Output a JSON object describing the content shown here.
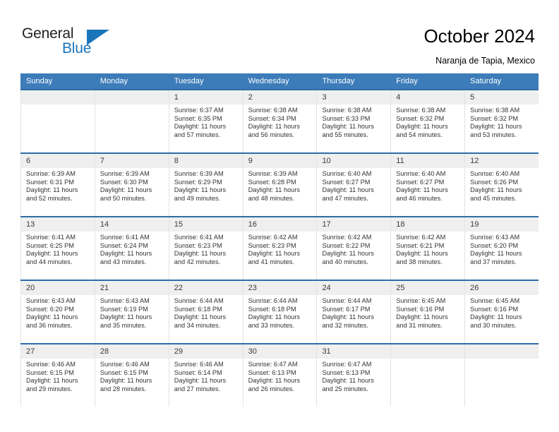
{
  "brand": {
    "name_top": "General",
    "name_bottom": "Blue",
    "accent_color": "#1b75bb",
    "triangle_icon": "brand-triangle-icon"
  },
  "header": {
    "title": "October 2024",
    "subtitle": "Naranja de Tapia, Mexico"
  },
  "calendar": {
    "header_color": "#3c7cb9",
    "row_border_color": "#2f6ca8",
    "day_band_color": "#efefef",
    "weekdays": [
      "Sunday",
      "Monday",
      "Tuesday",
      "Wednesday",
      "Thursday",
      "Friday",
      "Saturday"
    ],
    "weeks": [
      [
        {
          "day": "",
          "empty": true
        },
        {
          "day": "",
          "empty": true
        },
        {
          "day": "1",
          "sunrise": "Sunrise: 6:37 AM",
          "sunset": "Sunset: 6:35 PM",
          "daylight_1": "Daylight: 11 hours",
          "daylight_2": "and 57 minutes."
        },
        {
          "day": "2",
          "sunrise": "Sunrise: 6:38 AM",
          "sunset": "Sunset: 6:34 PM",
          "daylight_1": "Daylight: 11 hours",
          "daylight_2": "and 56 minutes."
        },
        {
          "day": "3",
          "sunrise": "Sunrise: 6:38 AM",
          "sunset": "Sunset: 6:33 PM",
          "daylight_1": "Daylight: 11 hours",
          "daylight_2": "and 55 minutes."
        },
        {
          "day": "4",
          "sunrise": "Sunrise: 6:38 AM",
          "sunset": "Sunset: 6:32 PM",
          "daylight_1": "Daylight: 11 hours",
          "daylight_2": "and 54 minutes."
        },
        {
          "day": "5",
          "sunrise": "Sunrise: 6:38 AM",
          "sunset": "Sunset: 6:32 PM",
          "daylight_1": "Daylight: 11 hours",
          "daylight_2": "and 53 minutes."
        }
      ],
      [
        {
          "day": "6",
          "sunrise": "Sunrise: 6:39 AM",
          "sunset": "Sunset: 6:31 PM",
          "daylight_1": "Daylight: 11 hours",
          "daylight_2": "and 52 minutes."
        },
        {
          "day": "7",
          "sunrise": "Sunrise: 6:39 AM",
          "sunset": "Sunset: 6:30 PM",
          "daylight_1": "Daylight: 11 hours",
          "daylight_2": "and 50 minutes."
        },
        {
          "day": "8",
          "sunrise": "Sunrise: 6:39 AM",
          "sunset": "Sunset: 6:29 PM",
          "daylight_1": "Daylight: 11 hours",
          "daylight_2": "and 49 minutes."
        },
        {
          "day": "9",
          "sunrise": "Sunrise: 6:39 AM",
          "sunset": "Sunset: 6:28 PM",
          "daylight_1": "Daylight: 11 hours",
          "daylight_2": "and 48 minutes."
        },
        {
          "day": "10",
          "sunrise": "Sunrise: 6:40 AM",
          "sunset": "Sunset: 6:27 PM",
          "daylight_1": "Daylight: 11 hours",
          "daylight_2": "and 47 minutes."
        },
        {
          "day": "11",
          "sunrise": "Sunrise: 6:40 AM",
          "sunset": "Sunset: 6:27 PM",
          "daylight_1": "Daylight: 11 hours",
          "daylight_2": "and 46 minutes."
        },
        {
          "day": "12",
          "sunrise": "Sunrise: 6:40 AM",
          "sunset": "Sunset: 6:26 PM",
          "daylight_1": "Daylight: 11 hours",
          "daylight_2": "and 45 minutes."
        }
      ],
      [
        {
          "day": "13",
          "sunrise": "Sunrise: 6:41 AM",
          "sunset": "Sunset: 6:25 PM",
          "daylight_1": "Daylight: 11 hours",
          "daylight_2": "and 44 minutes."
        },
        {
          "day": "14",
          "sunrise": "Sunrise: 6:41 AM",
          "sunset": "Sunset: 6:24 PM",
          "daylight_1": "Daylight: 11 hours",
          "daylight_2": "and 43 minutes."
        },
        {
          "day": "15",
          "sunrise": "Sunrise: 6:41 AM",
          "sunset": "Sunset: 6:23 PM",
          "daylight_1": "Daylight: 11 hours",
          "daylight_2": "and 42 minutes."
        },
        {
          "day": "16",
          "sunrise": "Sunrise: 6:42 AM",
          "sunset": "Sunset: 6:23 PM",
          "daylight_1": "Daylight: 11 hours",
          "daylight_2": "and 41 minutes."
        },
        {
          "day": "17",
          "sunrise": "Sunrise: 6:42 AM",
          "sunset": "Sunset: 6:22 PM",
          "daylight_1": "Daylight: 11 hours",
          "daylight_2": "and 40 minutes."
        },
        {
          "day": "18",
          "sunrise": "Sunrise: 6:42 AM",
          "sunset": "Sunset: 6:21 PM",
          "daylight_1": "Daylight: 11 hours",
          "daylight_2": "and 38 minutes."
        },
        {
          "day": "19",
          "sunrise": "Sunrise: 6:43 AM",
          "sunset": "Sunset: 6:20 PM",
          "daylight_1": "Daylight: 11 hours",
          "daylight_2": "and 37 minutes."
        }
      ],
      [
        {
          "day": "20",
          "sunrise": "Sunrise: 6:43 AM",
          "sunset": "Sunset: 6:20 PM",
          "daylight_1": "Daylight: 11 hours",
          "daylight_2": "and 36 minutes."
        },
        {
          "day": "21",
          "sunrise": "Sunrise: 6:43 AM",
          "sunset": "Sunset: 6:19 PM",
          "daylight_1": "Daylight: 11 hours",
          "daylight_2": "and 35 minutes."
        },
        {
          "day": "22",
          "sunrise": "Sunrise: 6:44 AM",
          "sunset": "Sunset: 6:18 PM",
          "daylight_1": "Daylight: 11 hours",
          "daylight_2": "and 34 minutes."
        },
        {
          "day": "23",
          "sunrise": "Sunrise: 6:44 AM",
          "sunset": "Sunset: 6:18 PM",
          "daylight_1": "Daylight: 11 hours",
          "daylight_2": "and 33 minutes."
        },
        {
          "day": "24",
          "sunrise": "Sunrise: 6:44 AM",
          "sunset": "Sunset: 6:17 PM",
          "daylight_1": "Daylight: 11 hours",
          "daylight_2": "and 32 minutes."
        },
        {
          "day": "25",
          "sunrise": "Sunrise: 6:45 AM",
          "sunset": "Sunset: 6:16 PM",
          "daylight_1": "Daylight: 11 hours",
          "daylight_2": "and 31 minutes."
        },
        {
          "day": "26",
          "sunrise": "Sunrise: 6:45 AM",
          "sunset": "Sunset: 6:16 PM",
          "daylight_1": "Daylight: 11 hours",
          "daylight_2": "and 30 minutes."
        }
      ],
      [
        {
          "day": "27",
          "sunrise": "Sunrise: 6:46 AM",
          "sunset": "Sunset: 6:15 PM",
          "daylight_1": "Daylight: 11 hours",
          "daylight_2": "and 29 minutes."
        },
        {
          "day": "28",
          "sunrise": "Sunrise: 6:46 AM",
          "sunset": "Sunset: 6:15 PM",
          "daylight_1": "Daylight: 11 hours",
          "daylight_2": "and 28 minutes."
        },
        {
          "day": "29",
          "sunrise": "Sunrise: 6:46 AM",
          "sunset": "Sunset: 6:14 PM",
          "daylight_1": "Daylight: 11 hours",
          "daylight_2": "and 27 minutes."
        },
        {
          "day": "30",
          "sunrise": "Sunrise: 6:47 AM",
          "sunset": "Sunset: 6:13 PM",
          "daylight_1": "Daylight: 11 hours",
          "daylight_2": "and 26 minutes."
        },
        {
          "day": "31",
          "sunrise": "Sunrise: 6:47 AM",
          "sunset": "Sunset: 6:13 PM",
          "daylight_1": "Daylight: 11 hours",
          "daylight_2": "and 25 minutes."
        },
        {
          "day": "",
          "empty": true
        },
        {
          "day": "",
          "empty": true
        }
      ]
    ]
  }
}
